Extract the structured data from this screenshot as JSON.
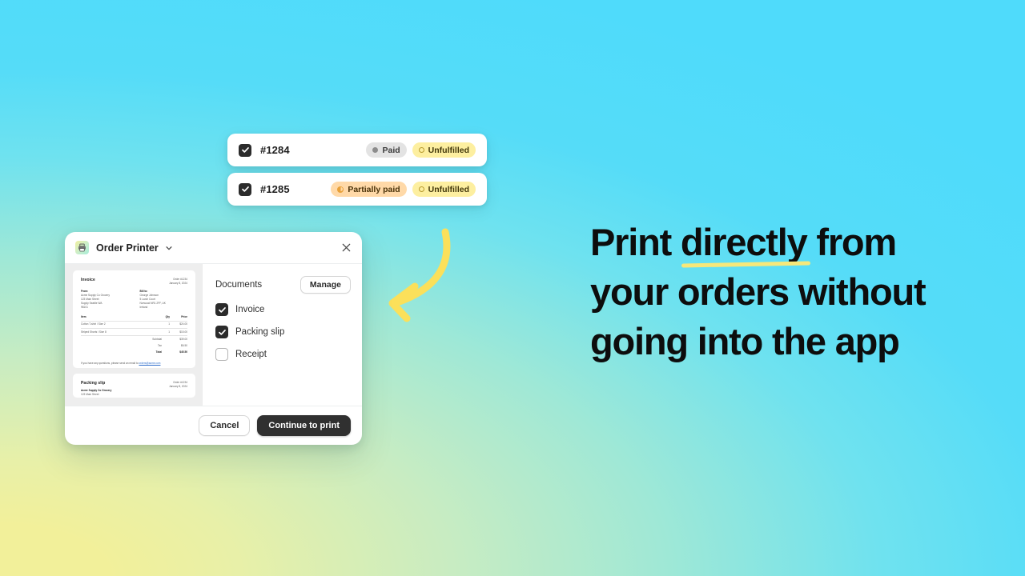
{
  "headline": {
    "part1": "Print ",
    "emphasis": "directly",
    "part2": " from your orders without going into the app"
  },
  "orders": [
    {
      "id": "#1284",
      "checked": true,
      "badges": [
        {
          "label": "Paid",
          "style": "paid",
          "icon": "dot-filled-icon"
        },
        {
          "label": "Unfulfilled",
          "style": "unfulfilled",
          "icon": "dot-ring-icon"
        }
      ]
    },
    {
      "id": "#1285",
      "checked": true,
      "badges": [
        {
          "label": "Partially paid",
          "style": "partial",
          "icon": "partial-pie-icon"
        },
        {
          "label": "Unfulfilled",
          "style": "unfulfilled",
          "icon": "dot-ring-icon"
        }
      ]
    }
  ],
  "modal": {
    "app_icon": "printer-icon",
    "title": "Order Printer",
    "chevron": "chevron-down-icon",
    "close": "close-icon",
    "documents_label": "Documents",
    "manage_label": "Manage",
    "options": [
      {
        "label": "Invoice",
        "checked": true
      },
      {
        "label": "Packing slip",
        "checked": true
      },
      {
        "label": "Receipt",
        "checked": false
      }
    ],
    "cancel_label": "Cancel",
    "primary_label": "Continue to print"
  },
  "preview": {
    "invoice": {
      "heading": "Invoice",
      "order_no": "Order #1234",
      "date": "January 8, 2024",
      "from_label": "From:",
      "from_lines": [
        "Acme Supply Co Grocery",
        "123 Main Street",
        "Supply Seattle WA",
        "98101"
      ],
      "to_label": "Bill to:",
      "to_lines": [
        "George Johnson",
        "5 Larch Court",
        "Norwood NR1 2FF, UK",
        "Ireland"
      ],
      "columns": [
        "Item",
        "Qty",
        "Price"
      ],
      "rows": [
        {
          "item": "Cotton T-shirt / Size 2",
          "qty": "1",
          "price": "$24.00"
        },
        {
          "item": "Striped Shorts / Size 8",
          "qty": "1",
          "price": "$15.00"
        }
      ],
      "totals": [
        {
          "label": "Subtotal",
          "value": "$39.00"
        },
        {
          "label": "Tax",
          "value": "$6.50"
        },
        {
          "label": "Total",
          "value": "$45.50"
        }
      ],
      "note_prefix": "If you have any questions, please send an email to ",
      "note_link": "orders@acme.com"
    },
    "packing": {
      "heading": "Packing slip",
      "order_no": "Order #1234",
      "date": "January 8, 2024",
      "line1": "Acme Supply Co Grocery",
      "line2": "123 Main Street"
    }
  },
  "colors": {
    "accent_yellow": "#f7e87a",
    "primary_dark": "#303030",
    "bg_cyan": "#4fdcfc",
    "bg_mint": "#a8ebc8",
    "bg_yellow": "#f2f09a"
  }
}
